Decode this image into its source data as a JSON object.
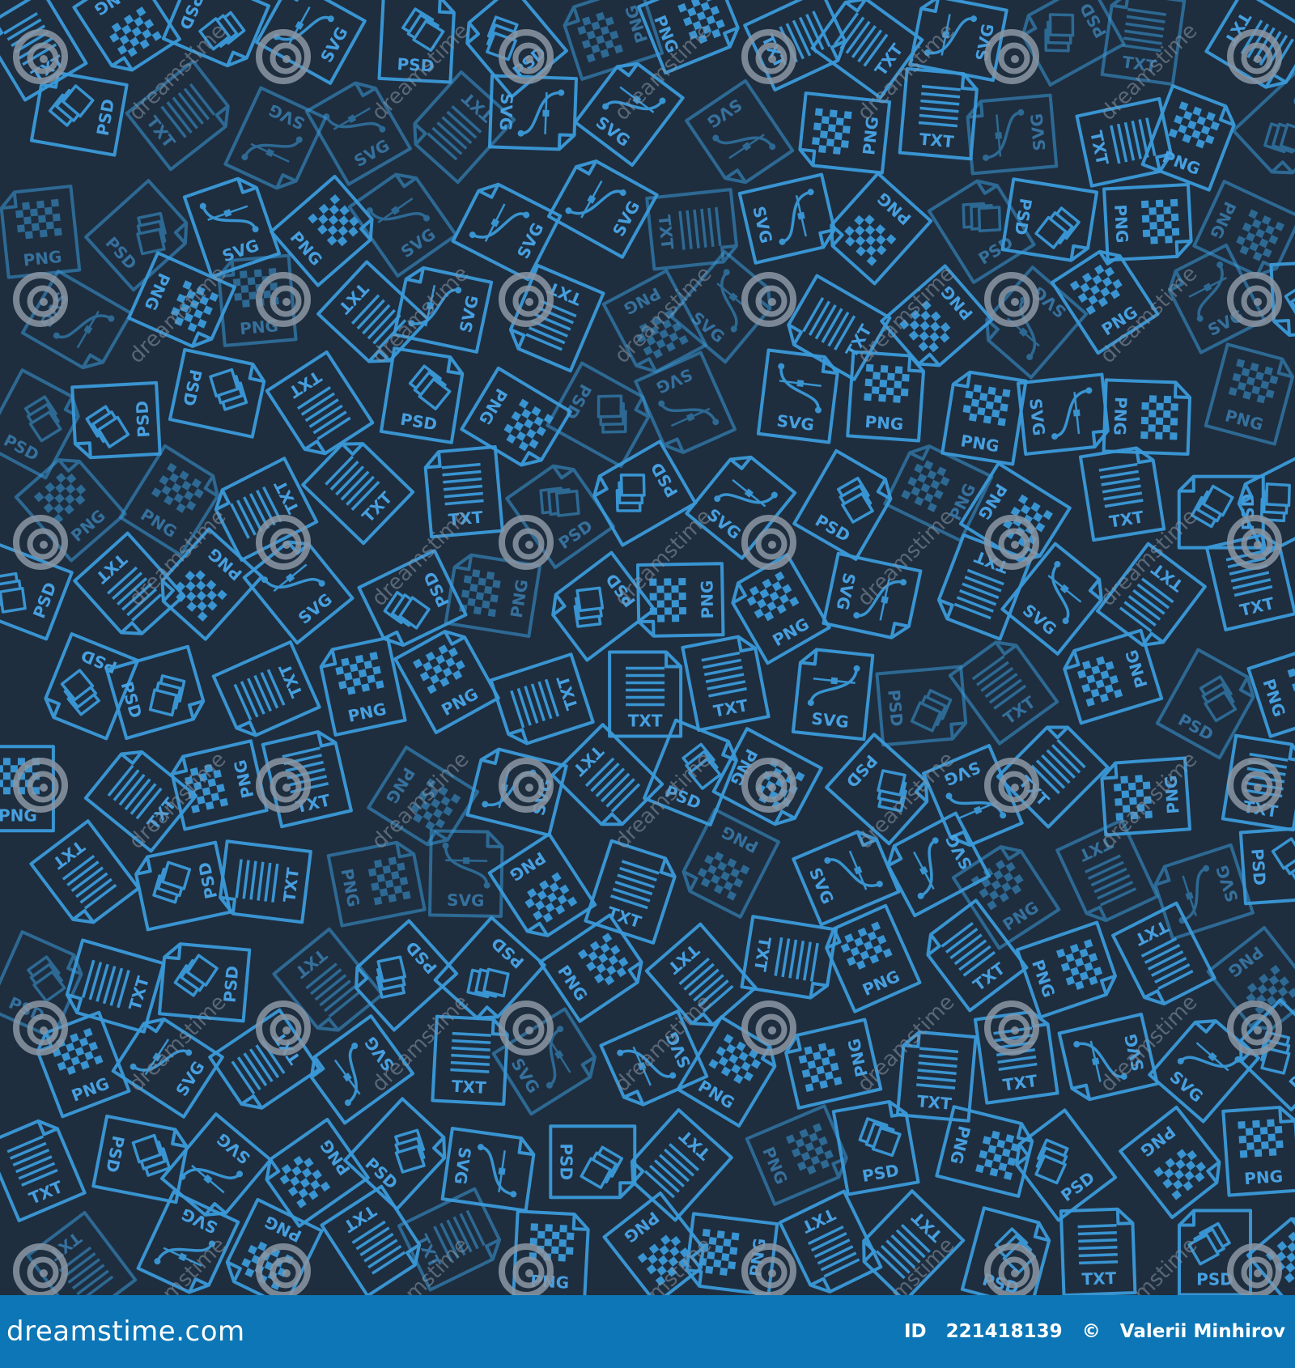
{
  "colors": {
    "background": "#1e2e3f",
    "icon_stroke": "#3b9ad9",
    "icon_text": "#4aa6e8",
    "watermark": "#8c97a3",
    "footer_bg": "#0c76b6",
    "footer_text": "#ffffff"
  },
  "pattern": {
    "file_types": [
      "PSD",
      "TXT",
      "SVG",
      "PNG"
    ],
    "watermark_text": "dreamstime",
    "watermark_icon": "spiral-icon"
  },
  "footer": {
    "logo": "dreamstime.com",
    "id_prefix": "ID",
    "id_number": "221418139",
    "copyright_symbol": "©",
    "author": "Valerii Minhirov"
  }
}
